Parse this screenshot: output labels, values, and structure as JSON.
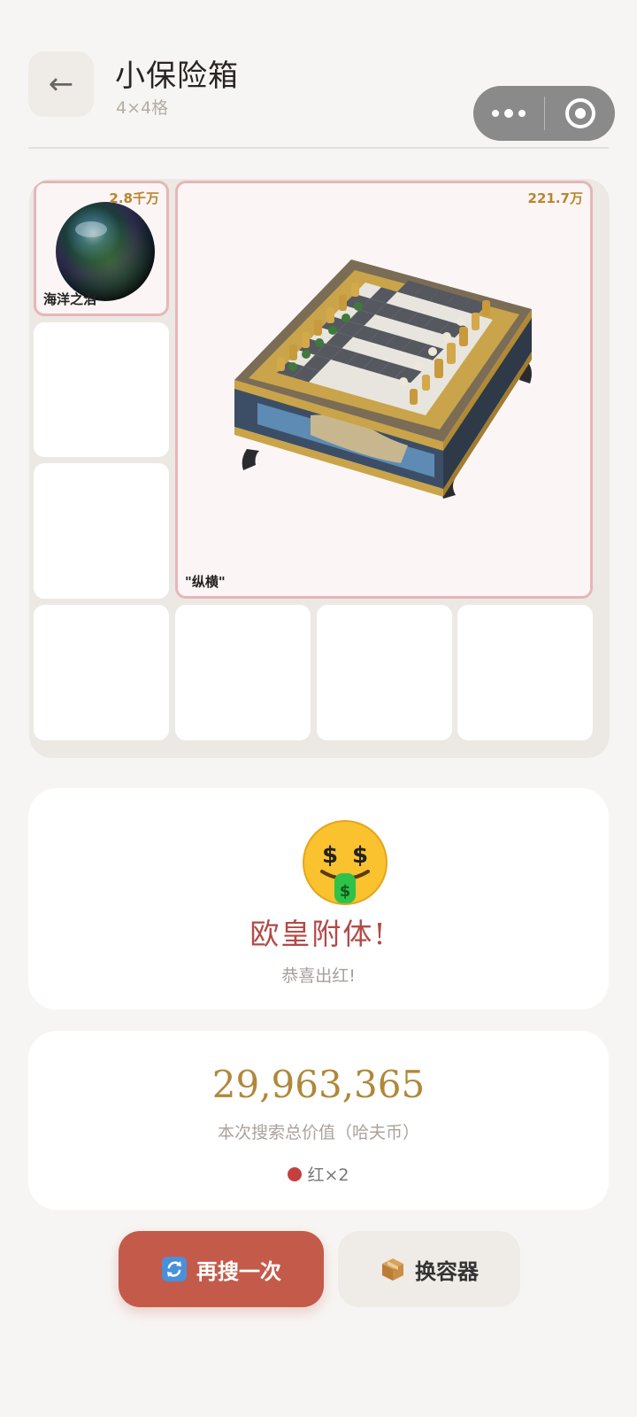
{
  "header": {
    "back_icon": "←",
    "title": "小保险箱",
    "subtitle": "4×4格"
  },
  "grid": {
    "items": [
      {
        "name": "海洋之泪",
        "price": "2.8千万"
      },
      {
        "name": "\"纵横\"",
        "price": "221.7万"
      }
    ]
  },
  "result": {
    "emoji": "money-mouth-face-icon",
    "title": "欧皇附体!",
    "subtitle": "恭喜出红!"
  },
  "value": {
    "total": "29,963,365",
    "label": "本次搜索总价值（哈夫币）",
    "red_count": "红×2",
    "red_color": "#c3403f"
  },
  "buttons": {
    "search_again": "再搜一次",
    "change_container": "换容器"
  },
  "colors": {
    "accent": "#c45a4a",
    "gold": "#b0883a",
    "item_border": "#e6b6b8"
  }
}
